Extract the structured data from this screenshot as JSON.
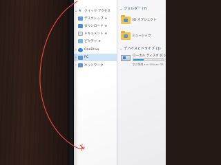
{
  "nav": {
    "quick_access": {
      "label": "クイック アクセス"
    },
    "items": [
      {
        "label": "デスクトップ",
        "pinned": true,
        "icon": "desktop-icon"
      },
      {
        "label": "ダウンロード",
        "pinned": true,
        "icon": "download-icon"
      },
      {
        "label": "ドキュメント",
        "pinned": true,
        "icon": "document-icon"
      },
      {
        "label": "ピクチャ",
        "pinned": true,
        "icon": "picture-icon"
      }
    ],
    "onedrive": {
      "label": "OneDrive"
    },
    "pc": {
      "label": "PC"
    },
    "network": {
      "label": "ネットワーク"
    },
    "pin_glyph": "✱"
  },
  "content": {
    "folders_header": "フォルダー (7)",
    "folders": [
      {
        "label": "3D オブジェクト"
      },
      {
        "label": "ミュージック"
      }
    ],
    "devices_header": "デバイスとドライブ (1)",
    "drive": {
      "label": "ローカル ディスク (C:)",
      "free_text": "空き領域 xxx GB/xxx GB",
      "used_fraction": 0.35
    }
  },
  "colors": {
    "selection": "#cfe3f8",
    "folder": "#f3c042",
    "accent": "#26a0da",
    "pen": "#e0453c"
  }
}
